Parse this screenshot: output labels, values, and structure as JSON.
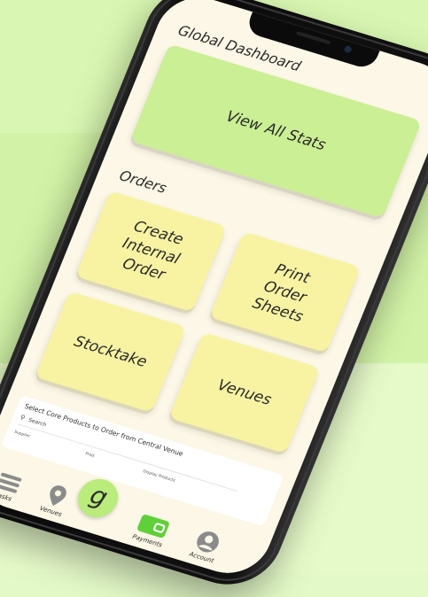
{
  "header": {
    "title": "Global Dashboard"
  },
  "stats": {
    "label": "View All Stats"
  },
  "orders": {
    "title": "Orders",
    "tiles": [
      {
        "label": "Create\nInternal\nOrder"
      },
      {
        "label": "Print\nOrder\nSheets"
      },
      {
        "label": "Stocktake"
      },
      {
        "label": "Venues"
      }
    ]
  },
  "panel": {
    "title": "Select Core Products to Order from Central Venue",
    "search_placeholder": "Search",
    "columns": [
      "Supplier",
      "Prod",
      "Display Products"
    ]
  },
  "tabbar": {
    "tabs": [
      {
        "label": "Tasks",
        "icon": "menu-icon"
      },
      {
        "label": "Venues",
        "icon": "location-pin-icon"
      },
      {
        "label": "g",
        "icon": "brand-logo-icon"
      },
      {
        "label": "Payments",
        "icon": "wallet-icon"
      },
      {
        "label": "Account",
        "icon": "user-icon"
      }
    ]
  },
  "colors": {
    "background": "#d6f5ad",
    "stats_card": "#cbef94",
    "tile": "#f7f3a2",
    "fab": "#b9ec7b",
    "screen": "#fcf7e6"
  }
}
